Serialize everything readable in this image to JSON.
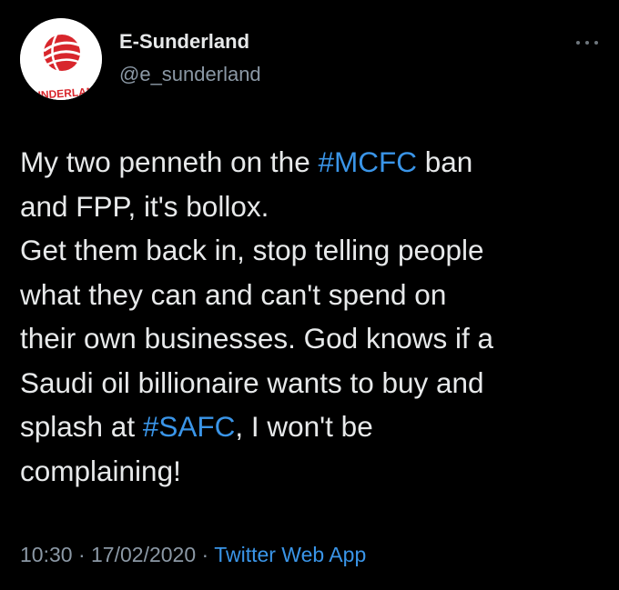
{
  "account": {
    "display_name": "E-Sunderland",
    "handle": "@e_sunderland",
    "avatar_text": "SUNDERLAND"
  },
  "more_icon": "ellipsis-icon",
  "tweet": {
    "lines": [
      {
        "pre": "My two penneth on the ",
        "tag": "#MCFC",
        "post": " ban"
      },
      {
        "pre": "and FPP, it's bollox.",
        "tag": "",
        "post": ""
      },
      {
        "pre": "Get them back in, stop telling people",
        "tag": "",
        "post": ""
      },
      {
        "pre": "what they can and can't spend on",
        "tag": "",
        "post": ""
      },
      {
        "pre": "their own businesses. God knows if a",
        "tag": "",
        "post": ""
      },
      {
        "pre": "Saudi oil billionaire wants to buy and",
        "tag": "",
        "post": ""
      },
      {
        "pre": "splash at ",
        "tag": "#SAFC",
        "post": ", I won't be"
      },
      {
        "pre": "complaining!",
        "tag": "",
        "post": ""
      }
    ]
  },
  "meta": {
    "time": "10:30",
    "separator": "·",
    "date": "17/02/2020",
    "source": "Twitter Web App"
  },
  "colors": {
    "background": "#000000",
    "text": "#e7e9ea",
    "secondary": "#8b98a5",
    "link": "#3a95e8",
    "avatar_red": "#d8262c"
  }
}
